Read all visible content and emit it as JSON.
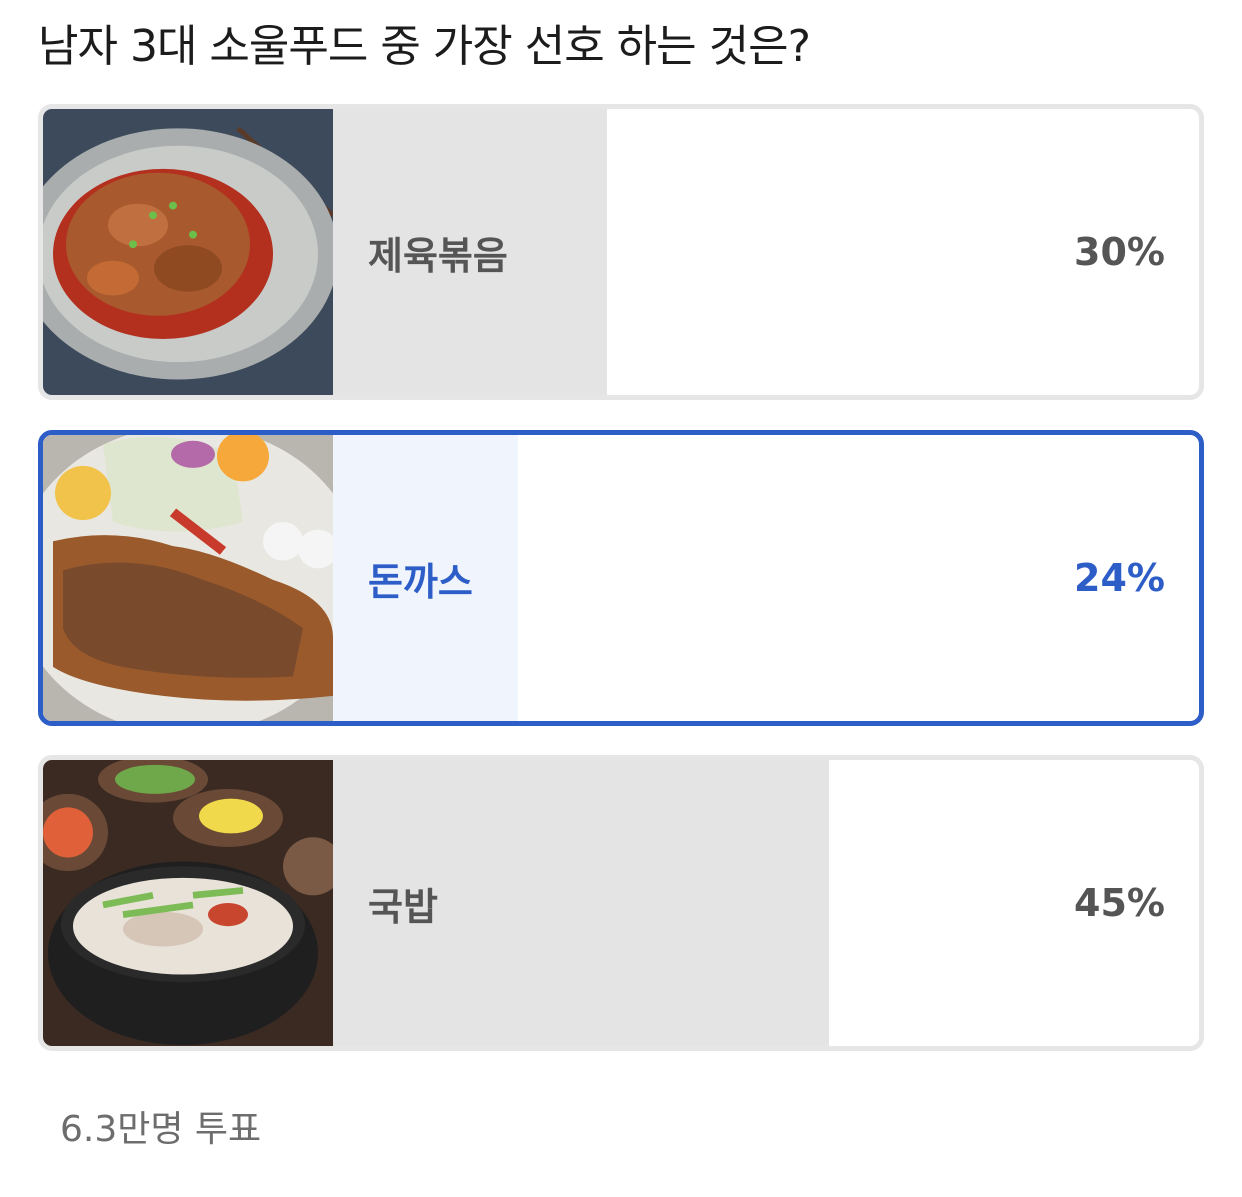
{
  "poll": {
    "question": "남자 3대 소울푸드 중 가장 선호 하는 것은?",
    "options": [
      {
        "label": "제육볶음",
        "percent": "30%",
        "share": 0.3,
        "image": "jeyuk-bokkeum-photo",
        "selected": false
      },
      {
        "label": "돈까스",
        "percent": "24%",
        "share": 0.24,
        "image": "donkatsu-photo",
        "selected": true
      },
      {
        "label": "국밥",
        "percent": "45%",
        "share": 0.45,
        "image": "gukbap-photo",
        "selected": false
      }
    ],
    "votes_text": "6.3만명 투표"
  },
  "colors": {
    "selected_accent": "#2d5dc7",
    "unselected_bar": "#e4e4e4",
    "selected_bar": "#f0f5fd",
    "text_gray": "#555555"
  }
}
